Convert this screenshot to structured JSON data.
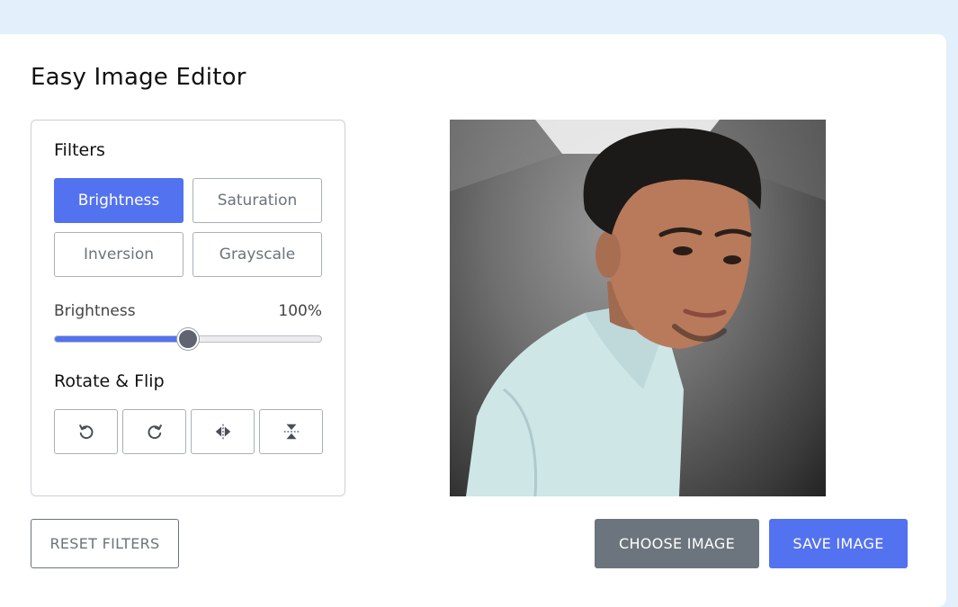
{
  "app": {
    "title": "Easy Image Editor"
  },
  "filters": {
    "heading": "Filters",
    "buttons": [
      {
        "label": "Brightness",
        "active": true
      },
      {
        "label": "Saturation",
        "active": false
      },
      {
        "label": "Inversion",
        "active": false
      },
      {
        "label": "Grayscale",
        "active": false
      }
    ],
    "slider": {
      "label": "Brightness",
      "value_text": "100%",
      "fraction": 0.5
    }
  },
  "rotate": {
    "heading": "Rotate & Flip",
    "buttons": [
      {
        "icon": "rotate-left-icon"
      },
      {
        "icon": "rotate-right-icon"
      },
      {
        "icon": "flip-horizontal-icon"
      },
      {
        "icon": "flip-vertical-icon"
      }
    ]
  },
  "actions": {
    "reset_label": "RESET FILTERS",
    "choose_label": "CHOOSE IMAGE",
    "save_label": "SAVE IMAGE"
  },
  "colors": {
    "accent": "#5372f0",
    "secondary": "#6c757d",
    "page_background": "#e3f0fb"
  }
}
